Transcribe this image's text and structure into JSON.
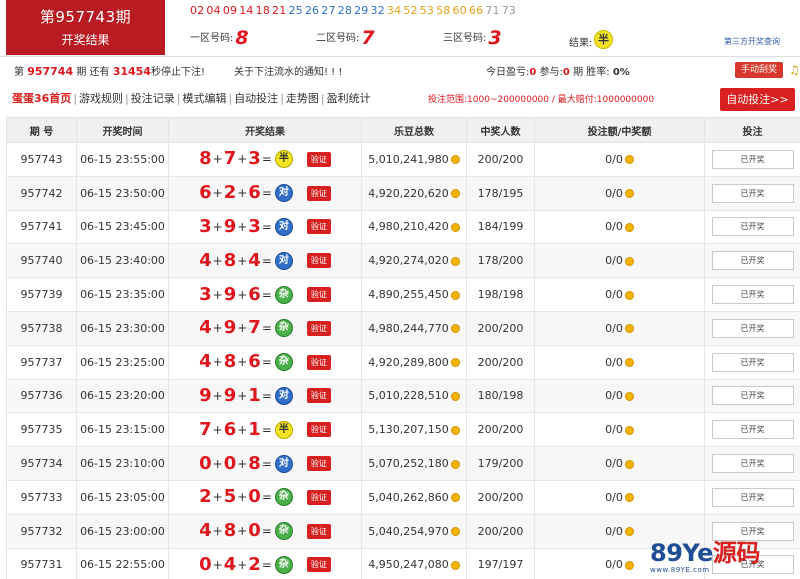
{
  "header": {
    "issue_title": "第957743期",
    "issue_subtitle": "开奖结果",
    "number_strip": [
      {
        "n": "02",
        "c": "#e0161d"
      },
      {
        "n": "04",
        "c": "#e0161d"
      },
      {
        "n": "09",
        "c": "#e0161d"
      },
      {
        "n": "14",
        "c": "#e0161d"
      },
      {
        "n": "18",
        "c": "#e0161d"
      },
      {
        "n": "21",
        "c": "#e0161d"
      },
      {
        "n": "25",
        "c": "#2f6ec9"
      },
      {
        "n": "26",
        "c": "#2f6ec9"
      },
      {
        "n": "27",
        "c": "#2f6ec9"
      },
      {
        "n": "28",
        "c": "#2f6ec9"
      },
      {
        "n": "29",
        "c": "#2f6ec9"
      },
      {
        "n": "32",
        "c": "#2f6ec9"
      },
      {
        "n": "34",
        "c": "#e3a21a"
      },
      {
        "n": "52",
        "c": "#e3a21a"
      },
      {
        "n": "53",
        "c": "#e3a21a"
      },
      {
        "n": "58",
        "c": "#e3a21a"
      },
      {
        "n": "60",
        "c": "#e3a21a"
      },
      {
        "n": "66",
        "c": "#e3a21a"
      },
      {
        "n": "71",
        "c": "#999999"
      },
      {
        "n": "73",
        "c": "#999999"
      }
    ],
    "zone1_label": "一区号码:",
    "zone1_value": "8",
    "zone2_label": "二区号码:",
    "zone2_value": "7",
    "zone3_label": "三区号码:",
    "zone3_value": "3",
    "result_label": "结果:",
    "result_value": "半",
    "third_party_link": "第三方开奖查询"
  },
  "notice_row": {
    "prefix": "第",
    "current_issue": "957744",
    "mid": "期 还有",
    "seconds": "31454",
    "suffix": "秒停止下注!",
    "notice_text": "关于下注流水的通知! ! !",
    "today_profit_label": "今日盈亏:",
    "today_profit": "0",
    "participate_label": "参与:",
    "participate": "0",
    "participate_unit": "期 胜率:",
    "win_rate": "0%",
    "manual_button": "手动刮奖"
  },
  "nav": {
    "items": [
      "蛋蛋36首页",
      "游戏规则",
      "投注记录",
      "模式编辑",
      "自动投注",
      "走势图",
      "盈利统计"
    ],
    "range_text": "投注范围:1000~200000000 / 最大赔付:1000000000",
    "auto_button": "自动投注>>"
  },
  "table": {
    "headers": [
      "期 号",
      "开奖时间",
      "开奖结果",
      "乐豆总数",
      "中奖人数",
      "投注额/中奖额",
      "投注"
    ],
    "verify_label": "验证",
    "action_label": "已开奖",
    "rows": [
      {
        "issue": "957743",
        "time": "06-15 23:55:00",
        "a": "8",
        "b": "7",
        "c": "3",
        "res": "半",
        "type": "ban",
        "total": "5,010,241,980",
        "winners": "200/200",
        "bet": "0/0"
      },
      {
        "issue": "957742",
        "time": "06-15 23:50:00",
        "a": "6",
        "b": "2",
        "c": "6",
        "res": "对",
        "type": "dui",
        "total": "4,920,220,620",
        "winners": "178/195",
        "bet": "0/0"
      },
      {
        "issue": "957741",
        "time": "06-15 23:45:00",
        "a": "3",
        "b": "9",
        "c": "3",
        "res": "对",
        "type": "dui",
        "total": "4,980,210,420",
        "winners": "184/199",
        "bet": "0/0"
      },
      {
        "issue": "957740",
        "time": "06-15 23:40:00",
        "a": "4",
        "b": "8",
        "c": "4",
        "res": "对",
        "type": "dui",
        "total": "4,920,274,020",
        "winners": "178/200",
        "bet": "0/0"
      },
      {
        "issue": "957739",
        "time": "06-15 23:35:00",
        "a": "3",
        "b": "9",
        "c": "6",
        "res": "杂",
        "type": "za",
        "total": "4,890,255,450",
        "winners": "198/198",
        "bet": "0/0"
      },
      {
        "issue": "957738",
        "time": "06-15 23:30:00",
        "a": "4",
        "b": "9",
        "c": "7",
        "res": "杂",
        "type": "za",
        "total": "4,980,244,770",
        "winners": "200/200",
        "bet": "0/0"
      },
      {
        "issue": "957737",
        "time": "06-15 23:25:00",
        "a": "4",
        "b": "8",
        "c": "6",
        "res": "杂",
        "type": "za",
        "total": "4,920,289,800",
        "winners": "200/200",
        "bet": "0/0"
      },
      {
        "issue": "957736",
        "time": "06-15 23:20:00",
        "a": "9",
        "b": "9",
        "c": "1",
        "res": "对",
        "type": "dui",
        "total": "5,010,228,510",
        "winners": "180/198",
        "bet": "0/0"
      },
      {
        "issue": "957735",
        "time": "06-15 23:15:00",
        "a": "7",
        "b": "6",
        "c": "1",
        "res": "半",
        "type": "ban",
        "total": "5,130,207,150",
        "winners": "200/200",
        "bet": "0/0"
      },
      {
        "issue": "957734",
        "time": "06-15 23:10:00",
        "a": "0",
        "b": "0",
        "c": "8",
        "res": "对",
        "type": "dui",
        "total": "5,070,252,180",
        "winners": "179/200",
        "bet": "0/0"
      },
      {
        "issue": "957733",
        "time": "06-15 23:05:00",
        "a": "2",
        "b": "5",
        "c": "0",
        "res": "杂",
        "type": "za",
        "total": "5,040,262,860",
        "winners": "200/200",
        "bet": "0/0"
      },
      {
        "issue": "957732",
        "time": "06-15 23:00:00",
        "a": "4",
        "b": "8",
        "c": "0",
        "res": "杂",
        "type": "za",
        "total": "5,040,254,970",
        "winners": "200/200",
        "bet": "0/0"
      },
      {
        "issue": "957731",
        "time": "06-15 22:55:00",
        "a": "0",
        "b": "4",
        "c": "2",
        "res": "杂",
        "type": "za",
        "total": "4,950,247,080",
        "winners": "197/197",
        "bet": "0/0"
      }
    ]
  },
  "watermark": {
    "brand_prefix": "89Ye",
    "brand_suffix": "源码",
    "site": "www.89YE.com"
  }
}
